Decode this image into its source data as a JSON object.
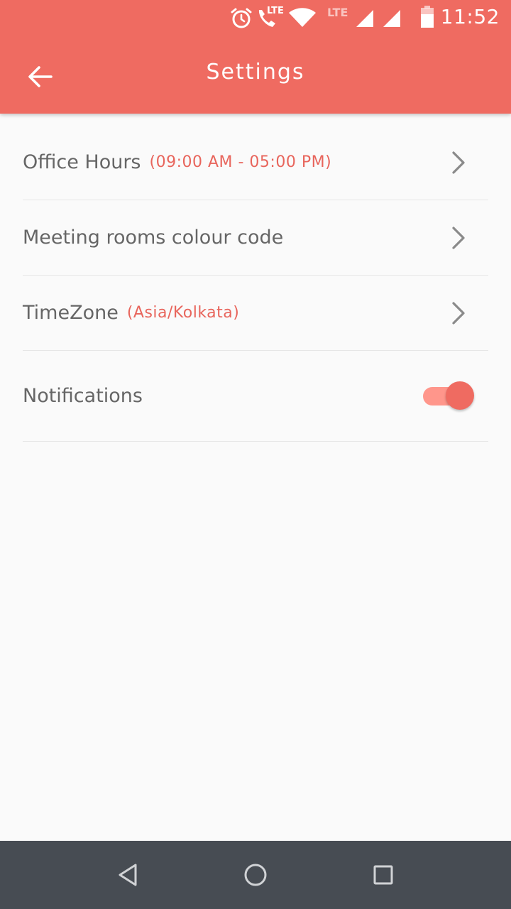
{
  "status_bar": {
    "time": "11:52",
    "call_badge": "LTE",
    "network_label": "LTE",
    "icons": [
      "alarm-icon",
      "volte-call-icon",
      "wifi-icon",
      "lte-label",
      "signal-icon",
      "signal-icon",
      "battery-icon"
    ]
  },
  "app_bar": {
    "title": "Settings",
    "back_icon": "arrow-left-icon",
    "color": "#ef6b61"
  },
  "settings": {
    "items": [
      {
        "label": "Office Hours",
        "value": "(09:00 AM - 05:00 PM)",
        "trailing": "chevron-right-icon"
      },
      {
        "label": "Meeting rooms colour code",
        "value": "",
        "trailing": "chevron-right-icon"
      },
      {
        "label": "TimeZone",
        "value": "(Asia/Kolkata)",
        "trailing": "chevron-right-icon"
      },
      {
        "label": "Notifications",
        "toggle_on": true
      }
    ]
  },
  "nav_bar": {
    "buttons": [
      "back-triangle-icon",
      "home-circle-icon",
      "recents-square-icon"
    ]
  },
  "colors": {
    "accent": "#ef6b61",
    "value_text": "#e8655c",
    "label_text": "#666666",
    "background": "#fafafa",
    "nav_bar": "#474c53"
  }
}
